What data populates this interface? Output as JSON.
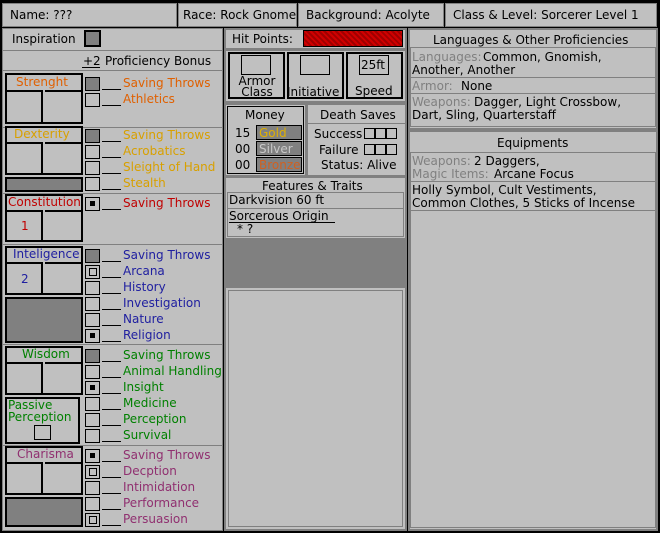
{
  "header": {
    "name": "Name: ???",
    "race": "Race: Rock Gnome",
    "background": "Background: Acolyte",
    "class_level": "Class & Level: Sorcerer Level 1"
  },
  "left": {
    "inspiration": "Inspiration",
    "prof_bonus_value": "+2",
    "prof_bonus_label": "Proficiency Bonus",
    "abilities": [
      {
        "name": "Strenght",
        "color": "#e06000",
        "score": ""
      },
      {
        "name": "Dexterity",
        "color": "#d8a000",
        "score": ""
      },
      {
        "name": "Constitution",
        "color": "#c00000",
        "score": "1"
      },
      {
        "name": "Inteligence",
        "color": "#2020a0",
        "score": "2"
      },
      {
        "name": "Wisdom",
        "color": "#008000",
        "score": ""
      },
      {
        "name": "Charisma",
        "color": "#903070",
        "score": ""
      }
    ],
    "passive_perception": "Passive Perception",
    "skills": {
      "str": [
        "Saving Throws",
        "Athletics"
      ],
      "dex": [
        "Saving Throws",
        "Acrobatics",
        "Sleight of Hand",
        "Stealth"
      ],
      "con": [
        "Saving Throws"
      ],
      "int": [
        "Saving Throws",
        "Arcana",
        "History",
        "Investigation",
        "Nature",
        "Religion"
      ],
      "wis": [
        "Saving Throws",
        "Animal Handling",
        "Insight",
        "Medicine",
        "Perception",
        "Survival"
      ],
      "cha": [
        "Saving Throws",
        "Decption",
        "Intimidation",
        "Performance",
        "Persuasion"
      ]
    }
  },
  "middle": {
    "hit_points": "Hit Points:",
    "armor_class": "Armor Class",
    "initiative": "Initiative",
    "speed_value": "25ft",
    "speed": "Speed",
    "money": {
      "title": "Money",
      "rows": [
        {
          "amount": "15",
          "coin": "Gold"
        },
        {
          "amount": "00",
          "coin": "Silver"
        },
        {
          "amount": "00",
          "coin": "Bronze"
        }
      ]
    },
    "death_saves": {
      "title": "Death Saves",
      "success": "Success",
      "failure": "Failure",
      "status": "Status: Alive"
    },
    "features": {
      "title": "Features & Traits",
      "items": [
        "Darkvision 60 ft",
        "Sorcerous Origin"
      ],
      "sub": "* ?"
    }
  },
  "right": {
    "languages": {
      "title": "Languages & Other Proficiencies",
      "languages_label": "Languages:",
      "languages_value": "Common, Gnomish,",
      "languages_value2": "Another, Another",
      "armor_label": "Armor:",
      "armor_value": "None",
      "weapons_label": "Weapons:",
      "weapons_value": "Dagger, Light Crossbow,",
      "weapons_value2": "Dart, Sling, Quarterstaff"
    },
    "equipment": {
      "title": "Equipments",
      "weapons_label": "Weapons:",
      "weapons_value": "2 Daggers,",
      "magic_label": "Magic Items:",
      "magic_value": "Arcane Focus",
      "other": "Holly Symbol, Cult Vestiments,",
      "other2": "Common Clothes, 5 Sticks of Incense"
    }
  }
}
